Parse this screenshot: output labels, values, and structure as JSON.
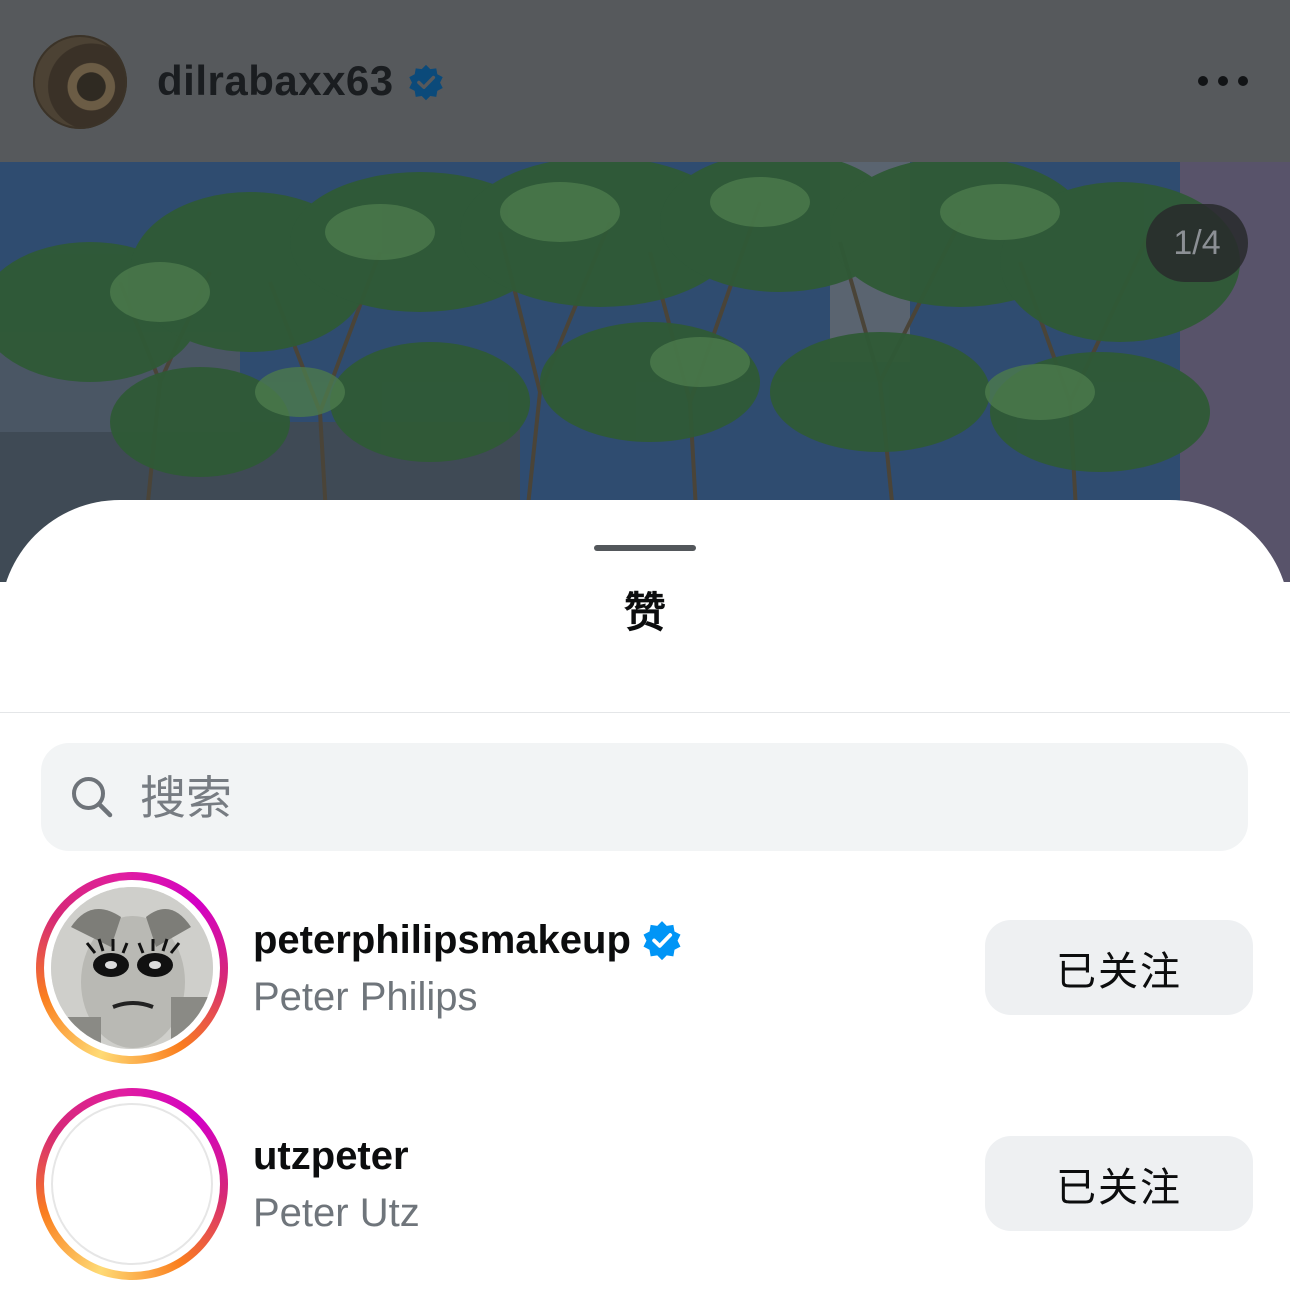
{
  "post": {
    "username": "dilrabaxx63",
    "verified": true,
    "image_counter": "1/4"
  },
  "sheet": {
    "title": "赞",
    "search": {
      "placeholder": "搜索",
      "value": ""
    },
    "users": [
      {
        "username": "peterphilipsmakeup",
        "verified": true,
        "full_name": "Peter Philips",
        "button": "已关注"
      },
      {
        "username": "utzpeter",
        "verified": false,
        "full_name": "Peter Utz",
        "button": "已关注"
      }
    ]
  },
  "colors": {
    "verified_blue": "#0095f6",
    "overlay_header": "#56595c",
    "button_bg": "#eef0f2"
  },
  "icons": {
    "verified": "verified-badge-icon",
    "more": "more-horizontal-icon",
    "search": "search-icon"
  }
}
